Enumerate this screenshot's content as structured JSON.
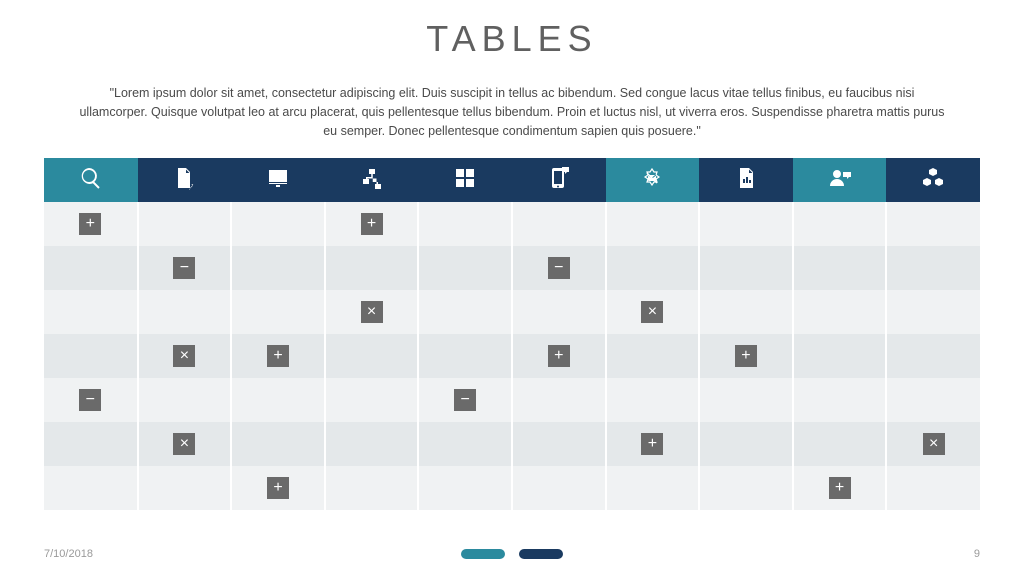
{
  "title": "TABLES",
  "subtitle": "\"Lorem ipsum dolor sit amet, consectetur adipiscing elit. Duis suscipit in tellus ac bibendum. Sed congue lacus vitae tellus finibus, eu faucibus nisi ullamcorper. Quisque volutpat leo at arcu placerat, quis pellentesque tellus bibendum. Proin et luctus nisl, ut viverra eros. Suspendisse pharetra mattis purus eu semper. Donec pellentesque condimentum sapien quis posuere.\"",
  "colors": {
    "teal": "#2b8a9e",
    "navy": "#1a3a60",
    "cell_mark_bg": "#6a6a6a"
  },
  "header": {
    "color_pattern": [
      "teal",
      "navy",
      "navy",
      "navy",
      "navy",
      "navy",
      "teal",
      "navy",
      "teal",
      "navy"
    ],
    "icons": [
      "search-icon",
      "document-pencil-icon",
      "monitor-icon",
      "org-chart-icon",
      "grid-icon",
      "mobile-chat-icon",
      "no-mail-icon",
      "bar-chart-doc-icon",
      "person-chat-icon",
      "cubes-icon"
    ]
  },
  "rows": [
    [
      "plus",
      "",
      "",
      "plus",
      "",
      "",
      "",
      "",
      "",
      ""
    ],
    [
      "",
      "minus",
      "",
      "",
      "",
      "minus",
      "",
      "",
      "",
      ""
    ],
    [
      "",
      "",
      "",
      "cross",
      "",
      "",
      "cross",
      "",
      "",
      ""
    ],
    [
      "",
      "cross",
      "plus",
      "",
      "",
      "plus",
      "",
      "plus",
      "",
      ""
    ],
    [
      "minus",
      "",
      "",
      "",
      "minus",
      "",
      "",
      "",
      "",
      ""
    ],
    [
      "",
      "cross",
      "",
      "",
      "",
      "",
      "plus",
      "",
      "",
      "cross"
    ],
    [
      "",
      "",
      "plus",
      "",
      "",
      "",
      "",
      "",
      "plus",
      ""
    ]
  ],
  "footer": {
    "date": "7/10/2018",
    "page": "9"
  }
}
